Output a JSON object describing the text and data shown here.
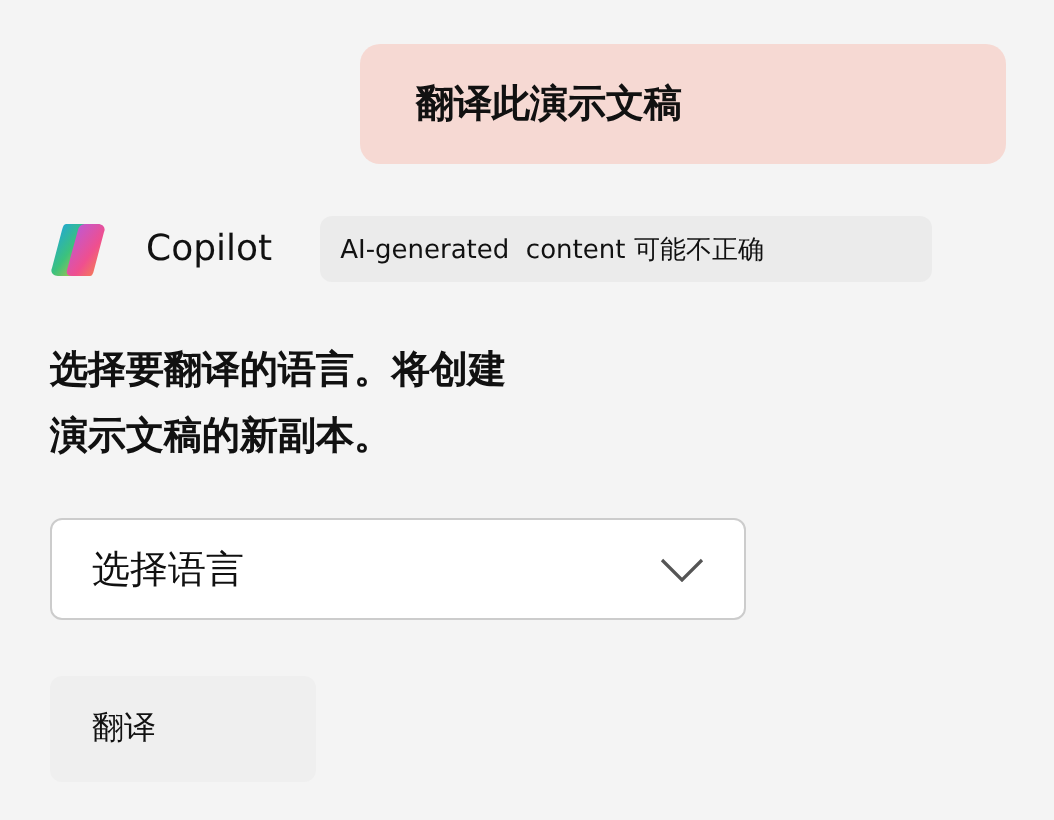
{
  "user_message": "翻译此演示文稿",
  "assistant": {
    "name": "Copilot",
    "disclaimer": "AI-generated  content 可能不正确"
  },
  "reply": "选择要翻译的语言。将创建演示文稿的新副本。",
  "language_select": {
    "placeholder": "选择语言"
  },
  "buttons": [
    "翻译"
  ]
}
